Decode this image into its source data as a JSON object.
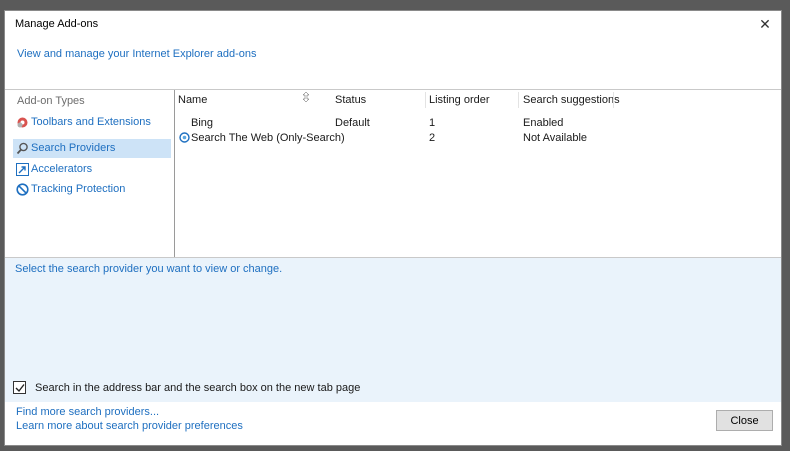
{
  "window": {
    "title": "Manage Add-ons",
    "close_glyph": "✕"
  },
  "header": {
    "text_part1": "View and manage your Internet Explorer add-ons"
  },
  "sidebar": {
    "heading": "Add-on Types",
    "items": [
      {
        "label": "Toolbars and Extensions",
        "icon": "gear-icon",
        "selected": false
      },
      {
        "label": "Search Providers",
        "icon": "search-icon",
        "selected": true
      },
      {
        "label": "Accelerators",
        "icon": "accelerator-icon",
        "selected": false
      },
      {
        "label": "Tracking Protection",
        "icon": "block-icon",
        "selected": false
      }
    ]
  },
  "list": {
    "columns": [
      "Name",
      "Status",
      "Listing order",
      "Search suggestions"
    ],
    "rows": [
      {
        "name": "Bing",
        "status": "Default",
        "order": "1",
        "suggestions": "Enabled",
        "icon": null
      },
      {
        "name": "Search The Web (Only-Search)",
        "status": "",
        "order": "2",
        "suggestions": "Not Available",
        "icon": "provider-icon"
      }
    ]
  },
  "details": {
    "hint": "Select the search provider you want to view or change.",
    "checkbox_label": "Search in the address bar and the search box on the new tab page",
    "checkbox_checked": true
  },
  "footer": {
    "link1": "Find more search providers...",
    "link2": "Learn more about search provider preferences",
    "close_label": "Close"
  },
  "colors": {
    "accent": "#1e6fc0",
    "selection": "#cde3f7",
    "details_bg": "#eaf3fb"
  }
}
